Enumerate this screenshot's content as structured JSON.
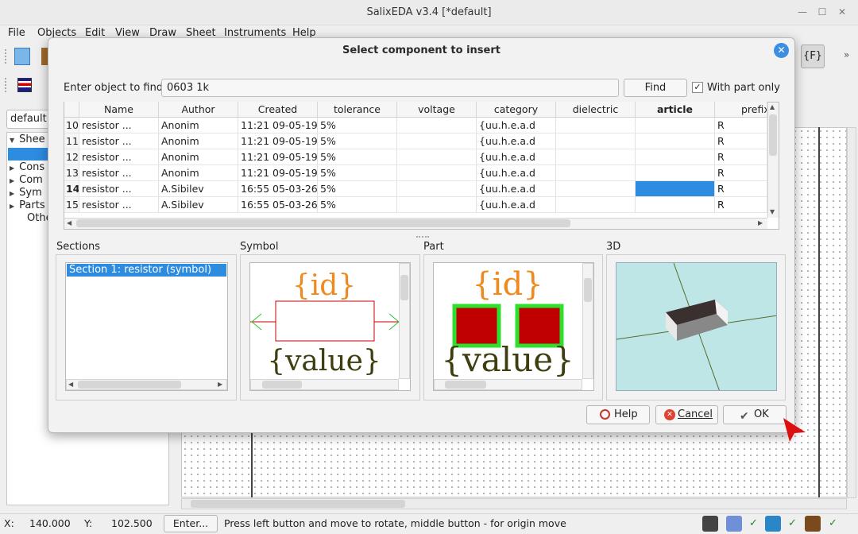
{
  "app": {
    "title": "SalixEDA v3.4 [*default]",
    "window_controls": [
      "—",
      "☐",
      "✕"
    ]
  },
  "menu": [
    "File",
    "Objects",
    "Edit",
    "View",
    "Draw",
    "Sheet",
    "Instruments",
    "Help"
  ],
  "left_panel": {
    "combo_value": "default",
    "tree": [
      {
        "label": "Shee",
        "expanded": true
      },
      {
        "label": "Cons",
        "expanded": false
      },
      {
        "label": "Com",
        "expanded": false
      },
      {
        "label": "Sym",
        "expanded": false
      },
      {
        "label": "Parts",
        "expanded": false
      },
      {
        "label": "Othe",
        "expanded": false
      }
    ]
  },
  "dialog": {
    "title": "Select component to insert",
    "find_label": "Enter object to find:",
    "search_value": "0603 1k",
    "find_button": "Find",
    "with_part_only_label": "With part only",
    "with_part_only_checked": true,
    "table": {
      "columns": [
        "Name",
        "Author",
        "Created",
        "tolerance",
        "voltage",
        "category",
        "dielectric",
        "article",
        "prefix"
      ],
      "rows": [
        {
          "num": "10",
          "name": "resistor ...",
          "author": "Anonim",
          "created": "11:21 09-05-19",
          "tolerance": "5%",
          "voltage": "",
          "category": "{uu.h.e.a.d",
          "dielectric": "",
          "article": "",
          "prefix": "R"
        },
        {
          "num": "11",
          "name": "resistor ...",
          "author": "Anonim",
          "created": "11:21 09-05-19",
          "tolerance": "5%",
          "voltage": "",
          "category": "{uu.h.e.a.d",
          "dielectric": "",
          "article": "",
          "prefix": "R"
        },
        {
          "num": "12",
          "name": "resistor ...",
          "author": "Anonim",
          "created": "11:21 09-05-19",
          "tolerance": "5%",
          "voltage": "",
          "category": "{uu.h.e.a.d",
          "dielectric": "",
          "article": "",
          "prefix": "R"
        },
        {
          "num": "13",
          "name": "resistor ...",
          "author": "Anonim",
          "created": "11:21 09-05-19",
          "tolerance": "5%",
          "voltage": "",
          "category": "{uu.h.e.a.d",
          "dielectric": "",
          "article": "",
          "prefix": "R"
        },
        {
          "num": "14",
          "name": "resistor ...",
          "author": "A.Sibilev",
          "created": "16:55 05-03-26",
          "tolerance": "5%",
          "voltage": "",
          "category": "{uu.h.e.a.d",
          "dielectric": "",
          "article": "",
          "prefix": "R"
        },
        {
          "num": "15",
          "name": "resistor ...",
          "author": "A.Sibilev",
          "created": "16:55 05-03-26",
          "tolerance": "5%",
          "voltage": "",
          "category": "{uu.h.e.a.d",
          "dielectric": "",
          "article": "",
          "prefix": "R"
        }
      ],
      "selected_row": "14"
    },
    "panels": {
      "sections_title": "Sections",
      "section_item": "Section 1: resistor (symbol)",
      "symbol_title": "Symbol",
      "part_title": "Part",
      "view3d_title": "3D",
      "id_text": "{id}",
      "value_text": "{value}"
    },
    "buttons": {
      "help": "Help",
      "cancel": "Cancel",
      "ok": "OK"
    }
  },
  "status": {
    "x_label": "X:",
    "x_value": "140.000",
    "y_label": "Y:",
    "y_value": "102.500",
    "enter_button": "Enter...",
    "message": "Press left button and move to rotate, middle button - for origin move"
  },
  "colors": {
    "accent": "#3c8fe0",
    "selection": "#2d8be0",
    "pad": "#c00000",
    "pad_outline": "#2ee02e",
    "orange_text": "#f08a1e",
    "olive_text": "#3e3e10"
  }
}
